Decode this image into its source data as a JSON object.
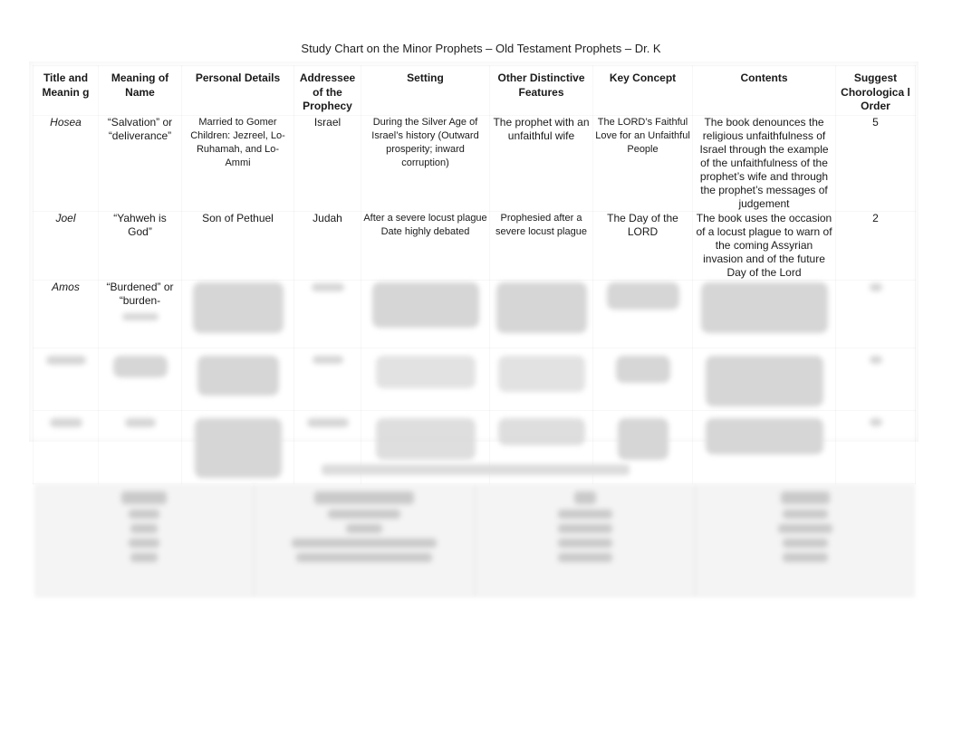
{
  "document": {
    "title": "Study Chart on the Minor Prophets – Old Testament Prophets – Dr. K"
  },
  "table": {
    "headers": [
      "Title and Meanin g",
      "Meaning of Name",
      "Personal Details",
      "Addressee of the Prophecy",
      "Setting",
      "Other Distinctive Features",
      "Key Concept",
      "Contents",
      "Suggest Chorologica l Order"
    ],
    "rows": [
      {
        "title": "Hosea",
        "meaning": "“Salvation” or “deliverance”",
        "personal": "Married to Gomer Children: Jezreel, Lo-Ruhamah, and Lo-Ammi",
        "addressee": "Israel",
        "setting": "During the Silver Age of Israel’s history (Outward prosperity; inward corruption)",
        "features": "The prophet with an unfaithful wife",
        "key_concept": "The LORD’s Faithful Love for an Unfaithful People",
        "contents": "The book denounces the religious unfaithfulness of Israel through the example of the unfaithfulness of the prophet’s wife and through the prophet’s messages of judgement",
        "order": "5"
      },
      {
        "title": "Joel",
        "meaning": "“Yahweh is God”",
        "personal": "Son of Pethuel",
        "addressee": "Judah",
        "setting_line1": "After a severe locust plague",
        "setting_line2": "Date highly debated",
        "features": "Prophesied after a severe locust plague",
        "key_concept": "The Day of the LORD",
        "contents": "The book uses the occasion of a locust plague to warn of the coming Assyrian invasion and of the future Day of the Lord",
        "order": "2"
      },
      {
        "title": "Amos",
        "meaning": "“Burdened” or “burden-",
        "blurred": true
      }
    ],
    "blurred_rows_count": 2
  }
}
